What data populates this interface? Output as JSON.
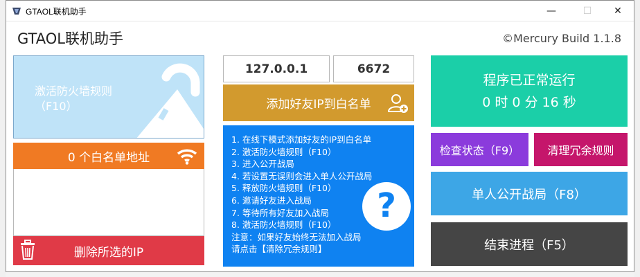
{
  "window": {
    "title": "GTAOL联机助手",
    "app_title": "GTAOL联机助手",
    "build": "©Mercury Build 1.1.8",
    "controls": {
      "minimize": "—",
      "maximize": "☐",
      "close": "✕"
    }
  },
  "firewall": {
    "label_line1": "激活防火墙规则",
    "label_line2": "（F10）",
    "icon": "lock-icon"
  },
  "whitelist": {
    "count_label": "0 个白名单地址",
    "icon": "wifi-icon"
  },
  "delete": {
    "label": "删除所选的IP",
    "icon": "trash-icon"
  },
  "ip": {
    "address": "127.0.0.1",
    "port": "6672"
  },
  "add_friend": {
    "label": "添加好友IP到白名单",
    "icon": "add-user-icon"
  },
  "guide": {
    "lines": [
      "1. 在线下模式添加好友的IP到白名单",
      "2. 激活防火墙规则（F10）",
      "3. 进入公开战局",
      "4. 若设置无误则会进入单人公开战局",
      "5. 释放防火墙规则（F10）",
      "6. 邀请好友进入战局",
      "7. 等待所有好友加入战局",
      "8. 激活防火墙规则（F10）",
      "注意：如果好友始终无法加入战局",
      "请点击【清除冗余规则】"
    ],
    "help_glyph": "?"
  },
  "status": {
    "line1": "程序已正常运行",
    "line2": "0 时   0 分 16 秒"
  },
  "buttons": {
    "check": "检查状态（F9）",
    "clean": "清理冗余规则",
    "single": "单人公开战局（F8）",
    "end": "结束进程（F5）"
  },
  "colors": {
    "orange": "#f07a23",
    "red": "#e03a47",
    "gold": "#d29a2e",
    "blue": "#0f82f1",
    "teal": "#1bcfa8",
    "purple": "#8b3bdc",
    "magenta": "#c5166b",
    "sky": "#3da6e6",
    "dark": "#454545"
  }
}
